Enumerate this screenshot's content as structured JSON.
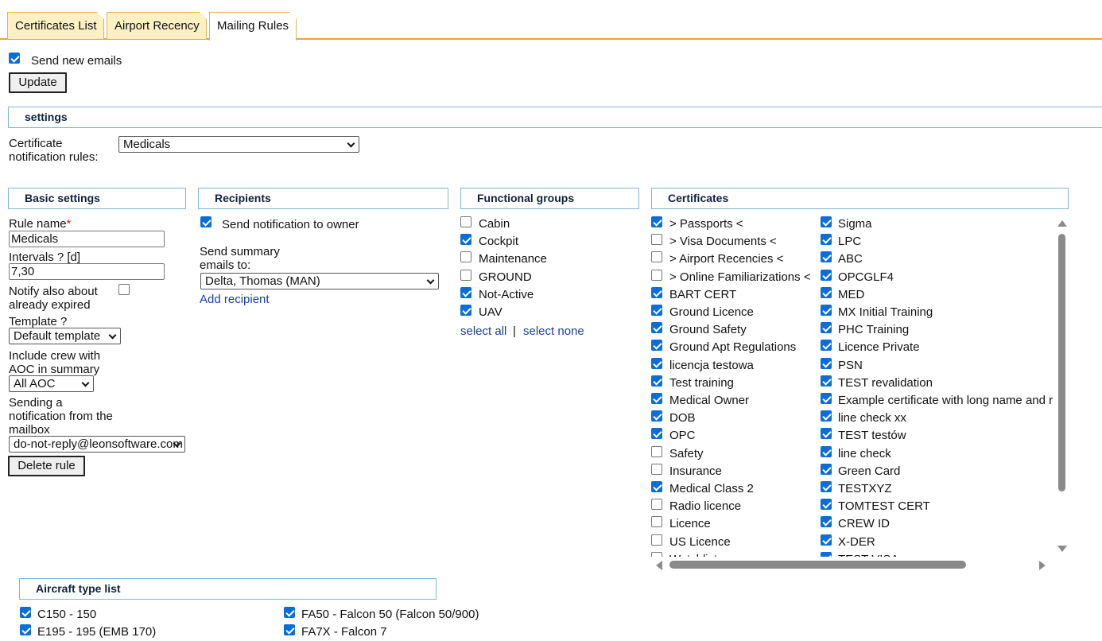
{
  "tabs": [
    {
      "label": "Certificates List"
    },
    {
      "label": "Airport Recency"
    },
    {
      "label": "Mailing Rules"
    }
  ],
  "send_new_emails": {
    "label": "Send new emails",
    "checked": true
  },
  "update_button": "Update",
  "settings": {
    "title": "settings"
  },
  "cert_rules": {
    "label_line1": "Certificate",
    "label_line2": "notification rules:",
    "value": "Medicals"
  },
  "basic": {
    "title": "Basic settings",
    "rule_name_label": "Rule name",
    "required_mark": "*",
    "rule_name_value": "Medicals",
    "intervals_label": "Intervals",
    "help_mark": "?",
    "intervals_unit": "[d]",
    "intervals_value": "7,30",
    "notify_line1": "Notify also about",
    "notify_line2": "already expired",
    "template_label": "Template",
    "template_value": "Default template",
    "include_line1": "Include crew with",
    "include_line2": "AOC in summary",
    "aoc_value": "All AOC",
    "mailbox_line1": "Sending a",
    "mailbox_line2": "notification from the",
    "mailbox_line3": "mailbox",
    "mailbox_value": "do-not-reply@leonsoftware.com",
    "delete_button": "Delete rule"
  },
  "recipients": {
    "title": "Recipients",
    "owner_label": "Send notification to owner",
    "summary_line1": "Send summary",
    "summary_line2": "emails to:",
    "summary_value": "Delta, Thomas (MAN)",
    "add_link": "Add recipient"
  },
  "groups": {
    "title": "Functional groups",
    "items": [
      {
        "label": "Cabin",
        "checked": false
      },
      {
        "label": "Cockpit",
        "checked": true
      },
      {
        "label": "Maintenance",
        "checked": false
      },
      {
        "label": "GROUND",
        "checked": false
      },
      {
        "label": "Not-Active",
        "checked": true
      },
      {
        "label": "UAV",
        "checked": true
      }
    ],
    "select_all": "select all",
    "separator": "|",
    "select_none": "select none"
  },
  "certificates": {
    "title": "Certificates",
    "col1": [
      {
        "label": "> Passports <",
        "checked": true
      },
      {
        "label": "> Visa Documents <",
        "checked": false
      },
      {
        "label": "> Airport Recencies <",
        "checked": false
      },
      {
        "label": "> Online Familiarizations <",
        "checked": false
      },
      {
        "label": "BART CERT",
        "checked": true
      },
      {
        "label": "Ground Licence",
        "checked": true
      },
      {
        "label": "Ground Safety",
        "checked": true
      },
      {
        "label": "Ground Apt Regulations",
        "checked": true
      },
      {
        "label": "licencja testowa",
        "checked": true
      },
      {
        "label": "Test training",
        "checked": true
      },
      {
        "label": "Medical Owner",
        "checked": true
      },
      {
        "label": "DOB",
        "checked": true
      },
      {
        "label": "OPC",
        "checked": true
      },
      {
        "label": "Safety",
        "checked": false
      },
      {
        "label": "Insurance",
        "checked": false
      },
      {
        "label": "Medical Class 2",
        "checked": true
      },
      {
        "label": "Radio licence",
        "checked": false
      },
      {
        "label": "Licence",
        "checked": false
      },
      {
        "label": "US Licence",
        "checked": false
      },
      {
        "label": "Watchlist",
        "checked": false
      }
    ],
    "col2": [
      {
        "label": "Sigma",
        "checked": true
      },
      {
        "label": "LPC",
        "checked": true
      },
      {
        "label": "ABC",
        "checked": true
      },
      {
        "label": "OPCGLF4",
        "checked": true
      },
      {
        "label": "MED",
        "checked": true
      },
      {
        "label": "MX Initial Training",
        "checked": true
      },
      {
        "label": "PHC Training",
        "checked": true
      },
      {
        "label": "Licence Private",
        "checked": true
      },
      {
        "label": "PSN",
        "checked": true
      },
      {
        "label": "TEST revalidation",
        "checked": true
      },
      {
        "label": "Example certificate with long name and r",
        "checked": true
      },
      {
        "label": "line check xx",
        "checked": true
      },
      {
        "label": "TEST testów",
        "checked": true
      },
      {
        "label": "line check",
        "checked": true
      },
      {
        "label": "Green Card",
        "checked": true
      },
      {
        "label": "TESTXYZ",
        "checked": true
      },
      {
        "label": "TOMTEST CERT",
        "checked": true
      },
      {
        "label": "CREW ID",
        "checked": true
      },
      {
        "label": "X-DER",
        "checked": true
      },
      {
        "label": "TEST VISA",
        "checked": true
      }
    ]
  },
  "aircraft": {
    "title": "Aircraft type list",
    "col1": [
      {
        "label": "C150 - 150",
        "checked": true
      },
      {
        "label": "E195 - 195 (EMB 170)",
        "checked": true
      }
    ],
    "col2": [
      {
        "label": "FA50 - Falcon 50 (Falcon 50/900)",
        "checked": true
      },
      {
        "label": "FA7X - Falcon 7",
        "checked": true
      }
    ]
  }
}
